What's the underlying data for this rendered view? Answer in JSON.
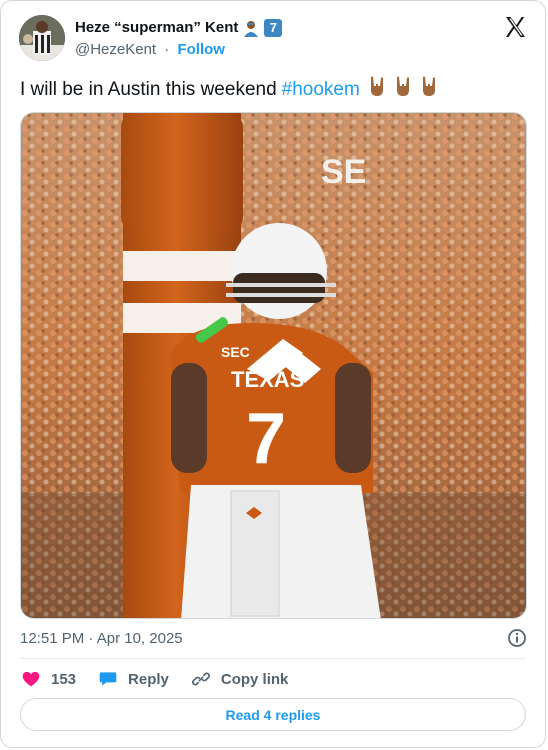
{
  "author": {
    "display_name": "Heze “superman” Kent",
    "badge_number": "7",
    "handle": "@HezeKent",
    "separator": "·",
    "follow_label": "Follow"
  },
  "tweet": {
    "text": "I will be in Austin this weekend",
    "hashtag": "#hookem",
    "emoji": [
      "🤘🏽",
      "🤘🏽",
      "🤘🏽"
    ],
    "jersey_number": "7",
    "jersey_text": "TEXAS",
    "patch_text": "SEC",
    "pole_text": "SE"
  },
  "meta": {
    "time": "12:51 PM",
    "separator": "·",
    "date": "Apr 10, 2025"
  },
  "actions": {
    "like_count": "153",
    "reply_label": "Reply",
    "copy_label": "Copy link",
    "read_replies_label": "Read 4 replies"
  },
  "colors": {
    "link": "#1d9bf0",
    "heart": "#f91880",
    "burnt_orange": "#bf5700"
  }
}
